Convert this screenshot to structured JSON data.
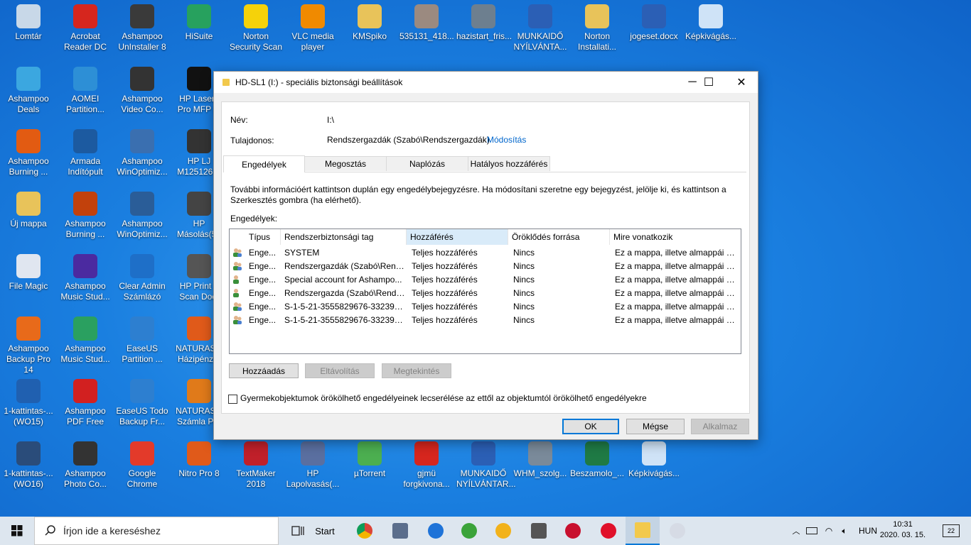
{
  "desktop": {
    "icons": [
      {
        "label": "Lomtár",
        "col": 0,
        "row": 0,
        "color": "#c8d8e8"
      },
      {
        "label": "Acrobat\nReader DC",
        "col": 1,
        "row": 0,
        "color": "#d6261e"
      },
      {
        "label": "Ashampoo\nUnInstaller 8",
        "col": 2,
        "row": 0,
        "color": "#3a3a3a"
      },
      {
        "label": "HiSuite",
        "col": 3,
        "row": 0,
        "color": "#27a15e"
      },
      {
        "label": "Norton\nSecurity Scan",
        "col": 4,
        "row": 0,
        "color": "#f5d20a"
      },
      {
        "label": "VLC media\nplayer",
        "col": 5,
        "row": 0,
        "color": "#f08a00"
      },
      {
        "label": "KMSpiko",
        "col": 6,
        "row": 0,
        "color": "#e8c35a"
      },
      {
        "label": "535131_418...",
        "col": 7,
        "row": 0,
        "color": "#9b8a80"
      },
      {
        "label": "hazistart_fris...",
        "col": 8,
        "row": 0,
        "color": "#6d7f8f"
      },
      {
        "label": "MUNKAIDŐ\nNYÍLVÁNTA...",
        "col": 9,
        "row": 0,
        "color": "#2b5fb5"
      },
      {
        "label": "Norton\nInstallati...",
        "col": 10,
        "row": 0,
        "color": "#e8c35a"
      },
      {
        "label": "jogeset.docx",
        "col": 11,
        "row": 0,
        "color": "#2b5fb5"
      },
      {
        "label": "Képkivágás...",
        "col": 12,
        "row": 0,
        "color": "#cfe3f7"
      },
      {
        "label": "Ashampoo\nDeals",
        "col": 0,
        "row": 1,
        "color": "#3ba7e0"
      },
      {
        "label": "AOMEI\nPartition...",
        "col": 1,
        "row": 1,
        "color": "#2d8fd6"
      },
      {
        "label": "Ashampoo\nVideo Co...",
        "col": 2,
        "row": 1,
        "color": "#333333"
      },
      {
        "label": "HP LaserJ\nPro MFP M",
        "col": 3,
        "row": 1,
        "color": "#111111"
      },
      {
        "label": "Ashampoo\nBurning ...",
        "col": 0,
        "row": 2,
        "color": "#e25b12"
      },
      {
        "label": "Armada\nIndítópult",
        "col": 1,
        "row": 2,
        "color": "#1c5aa0"
      },
      {
        "label": "Ashampoo\nWinOptimiz...",
        "col": 2,
        "row": 2,
        "color": "#3a6fb0"
      },
      {
        "label": "HP LJ\nM125126 S",
        "col": 3,
        "row": 2,
        "color": "#333333"
      },
      {
        "label": "Új mappa",
        "col": 0,
        "row": 3,
        "color": "#e8c35a"
      },
      {
        "label": "Ashampoo\nBurning ...",
        "col": 1,
        "row": 3,
        "color": "#c2410c"
      },
      {
        "label": "Ashampoo\nWinOptimiz...",
        "col": 2,
        "row": 3,
        "color": "#2a5d98"
      },
      {
        "label": "HP\nMásolás(55",
        "col": 3,
        "row": 3,
        "color": "#444444"
      },
      {
        "label": "File Magic",
        "col": 0,
        "row": 4,
        "color": "#e0e6f0"
      },
      {
        "label": "Ashampoo\nMusic Stud...",
        "col": 1,
        "row": 4,
        "color": "#4b2aa0"
      },
      {
        "label": "Clear Admin\nSzámlázó",
        "col": 2,
        "row": 4,
        "color": "#1e6fc8"
      },
      {
        "label": "HP Print a\nScan Doct",
        "col": 3,
        "row": 4,
        "color": "#555555"
      },
      {
        "label": "Ashampoo\nBackup Pro 14",
        "col": 0,
        "row": 5,
        "color": "#e86a1a"
      },
      {
        "label": "Ashampoo\nMusic Stud...",
        "col": 1,
        "row": 5,
        "color": "#2aa060"
      },
      {
        "label": "EaseUS\nPartition ...",
        "col": 2,
        "row": 5,
        "color": "#2d7fd0"
      },
      {
        "label": "NATURASO\nHázipénztá",
        "col": 3,
        "row": 5,
        "color": "#e05a1a"
      },
      {
        "label": "1-kattintas-...\n(WO15)",
        "col": 0,
        "row": 6,
        "color": "#2060b0"
      },
      {
        "label": "Ashampoo\nPDF Free",
        "col": 1,
        "row": 6,
        "color": "#d22020"
      },
      {
        "label": "EaseUS Todo\nBackup Fr...",
        "col": 2,
        "row": 6,
        "color": "#2d7fd0"
      },
      {
        "label": "NATURASO\nSzámla Pro",
        "col": 3,
        "row": 6,
        "color": "#e07a1a"
      },
      {
        "label": "1-kattintas-...\n(WO16)",
        "col": 0,
        "row": 7,
        "color": "#2a4c7a"
      },
      {
        "label": "Ashampoo\nPhoto Co...",
        "col": 1,
        "row": 7,
        "color": "#333333"
      },
      {
        "label": "Google\nChrome",
        "col": 2,
        "row": 7,
        "color": "#e33a2a"
      },
      {
        "label": "Nitro Pro 8",
        "col": 3,
        "row": 7,
        "color": "#e05a1a"
      },
      {
        "label": "TextMaker\n2018",
        "col": 4,
        "row": 7,
        "color": "#c0202a"
      },
      {
        "label": "HP\nLapolvasás(...",
        "col": 5,
        "row": 7,
        "color": "#5a6fa0"
      },
      {
        "label": "µTorrent",
        "col": 6,
        "row": 7,
        "color": "#4caf50"
      },
      {
        "label": "gjmü\nforgkivona...",
        "col": 7,
        "row": 7,
        "color": "#d6261e"
      },
      {
        "label": "MUNKAIDŐ\nNYÍLVÁNTAR...",
        "col": 8,
        "row": 7,
        "color": "#2b5fb5"
      },
      {
        "label": "WHM_szolg...",
        "col": 9,
        "row": 7,
        "color": "#7a8a9a"
      },
      {
        "label": "Beszamolo_...",
        "col": 10,
        "row": 7,
        "color": "#1f7a45"
      },
      {
        "label": "Képkivágás...",
        "col": 11,
        "row": 7,
        "color": "#cfe3f7"
      }
    ]
  },
  "dialog": {
    "title": "HD-SL1 (I:) - speciális biztonsági beállítások",
    "name_label": "Név:",
    "name_value": "I:\\",
    "owner_label": "Tulajdonos:",
    "owner_value": "Rendszergazdák (Szabó\\Rendszergazdák)",
    "change_link": "Módosítás",
    "tabs": [
      "Engedélyek",
      "Megosztás",
      "Naplózás",
      "Hatályos hozzáférés"
    ],
    "active_tab": "Engedélyek",
    "info_text": "További információért kattintson duplán egy engedélybejegyzésre. Ha módosítani szeretne egy bejegyzést, jelölje ki, és kattintson a Szerkesztés gombra (ha elérhető).",
    "permissions_label": "Engedélyek:",
    "columns": [
      "Típus",
      "Rendszerbiztonsági tag",
      "Hozzáférés",
      "Öröklődés forrása",
      "Mire vonatkozik"
    ],
    "rows": [
      {
        "type": "Enge...",
        "principal": "SYSTEM",
        "access": "Teljes hozzáférés",
        "inherited": "Nincs",
        "applies": "Ez a mappa, illetve almappái é...",
        "icon": "group-user-icon"
      },
      {
        "type": "Enge...",
        "principal": "Rendszergazdák (Szabó\\Rend...",
        "access": "Teljes hozzáférés",
        "inherited": "Nincs",
        "applies": "Ez a mappa, illetve almappái é...",
        "icon": "group-user-icon"
      },
      {
        "type": "Enge...",
        "principal": "Special account for Ashampo...",
        "access": "Teljes hozzáférés",
        "inherited": "Nincs",
        "applies": "Ez a mappa, illetve almappái é...",
        "icon": "single-user-icon"
      },
      {
        "type": "Enge...",
        "principal": "Rendszergazda (Szabó\\Rendsz...",
        "access": "Teljes hozzáférés",
        "inherited": "Nincs",
        "applies": "Ez a mappa, illetve almappái é...",
        "icon": "single-user-icon"
      },
      {
        "type": "Enge...",
        "principal": "S-1-5-21-3555829676-3323913...",
        "access": "Teljes hozzáférés",
        "inherited": "Nincs",
        "applies": "Ez a mappa, illetve almappái é...",
        "icon": "unknown-user-icon"
      },
      {
        "type": "Enge...",
        "principal": "S-1-5-21-3555829676-3323913...",
        "access": "Teljes hozzáférés",
        "inherited": "Nincs",
        "applies": "Ez a mappa, illetve almappái é...",
        "icon": "unknown-user-icon"
      }
    ],
    "add_btn": "Hozzáadás",
    "remove_btn": "Eltávolítás",
    "view_btn": "Megtekintés",
    "replace_checkbox": "Gyermekobjektumok örökölhető engedélyeinek lecserélése az ettől az objektumtól örökölhető engedélyekre",
    "ok_btn": "OK",
    "cancel_btn": "Mégse",
    "apply_btn": "Alkalmaz"
  },
  "taskbar": {
    "search_placeholder": "Írjon ide a kereséshez",
    "start_label": "Start",
    "language": "HUN",
    "time": "10:31",
    "date": "2020. 03. 15.",
    "notifications": "22"
  },
  "colors": {
    "accent": "#0078d7",
    "link": "#0066cc",
    "desktop_bg": "#1a7fe0"
  }
}
